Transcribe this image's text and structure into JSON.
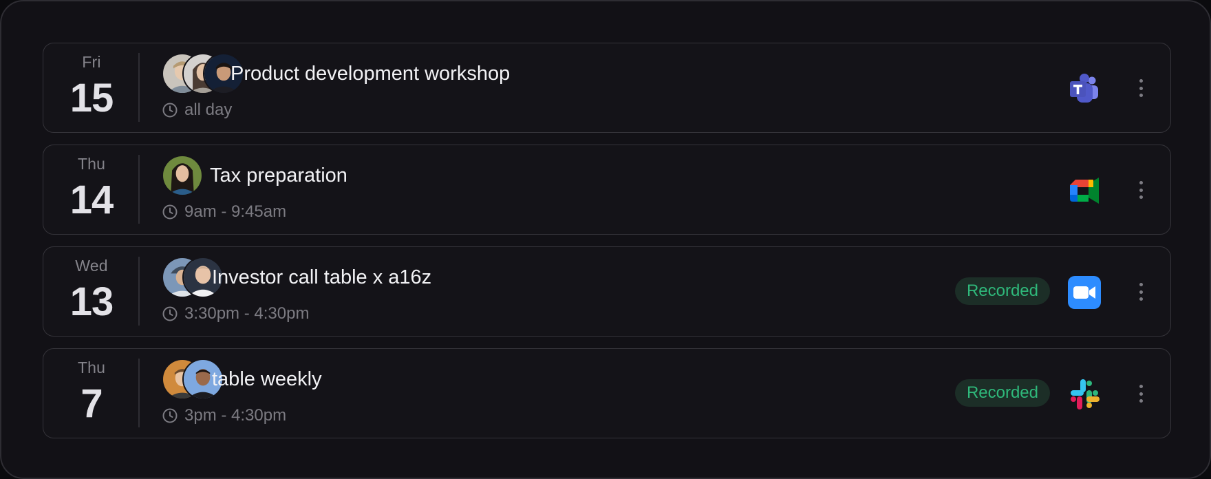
{
  "events": [
    {
      "weekday": "Fri",
      "day": "15",
      "title": "Product development workshop",
      "time": "all day",
      "avatars": [
        "avatar-man-blond",
        "avatar-woman-long-hair",
        "avatar-man-dark-hair"
      ],
      "app": "microsoft-teams-icon",
      "badge": ""
    },
    {
      "weekday": "Thu",
      "day": "14",
      "title": "Tax preparation",
      "time": "9am - 9:45am",
      "avatars": [
        "avatar-woman-dark-hair"
      ],
      "app": "google-meet-icon",
      "badge": ""
    },
    {
      "weekday": "Wed",
      "day": "13",
      "title": "Investor call table x a16z",
      "time": "3:30pm - 4:30pm",
      "avatars": [
        "avatar-man-cap",
        "avatar-man-bald"
      ],
      "app": "zoom-icon",
      "badge": "Recorded"
    },
    {
      "weekday": "Thu",
      "day": "7",
      "title": "table weekly",
      "time": "3pm - 4:30pm",
      "avatars": [
        "avatar-man-orange-bg",
        "avatar-man-blue-bg"
      ],
      "app": "slack-icon",
      "badge": "Recorded"
    }
  ],
  "colors": {
    "badge_text": "#2fb97b",
    "badge_bg": "#1c2e27",
    "card_border": "#35343a",
    "background": "#121116"
  }
}
